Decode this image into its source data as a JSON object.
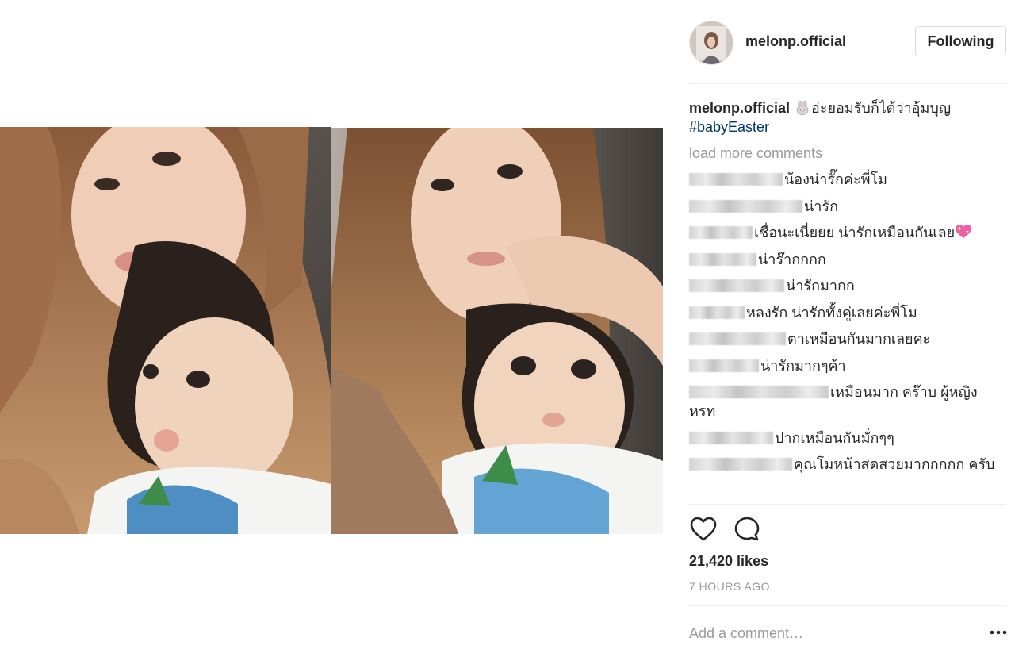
{
  "post": {
    "username": "melonp.official",
    "follow_label": "Following",
    "caption_user": "melonp.official",
    "caption_text": "อ่ะยอมรับก็ได้ว่าอุ้มบุญ",
    "caption_emoji": "rabbit-face-icon",
    "hashtag": "#babyEaster",
    "load_more": "load more comments",
    "comments": [
      {
        "text": "น้องน่ารั๊กค่ะพี่โม"
      },
      {
        "text": "น่ารัก"
      },
      {
        "text": "เชื่อนะเนี่ยยย น่ารักเหมือนกันเลย",
        "emoji": "sparkling-heart-icon"
      },
      {
        "text": "น่าร๊ากกกก"
      },
      {
        "text": "น่ารักมากก"
      },
      {
        "text": "หลงรัก น่ารักทั้งคู่เลยค่ะพี่โม"
      },
      {
        "text": "ตาเหมือนกันมากเลยคะ"
      },
      {
        "text": "น่ารักมากๆค้า"
      },
      {
        "text": "เหมือนมาก คร๊าบ ผู้หญิง หรท"
      },
      {
        "text": "ปากเหมือนกันมั่กๆๆ"
      },
      {
        "text": "คุณโมหน้าสดสวยมากกกกก ครับ"
      }
    ],
    "likes": "21,420 likes",
    "time": "7 HOURS AGO",
    "add_comment_placeholder": "Add a comment…",
    "more_icon": "ellipsis-icon"
  },
  "colors": {
    "text": "#262626",
    "muted": "#999999",
    "hashtag": "#003569",
    "border": "#dbdbdb",
    "divider": "#efefef"
  }
}
